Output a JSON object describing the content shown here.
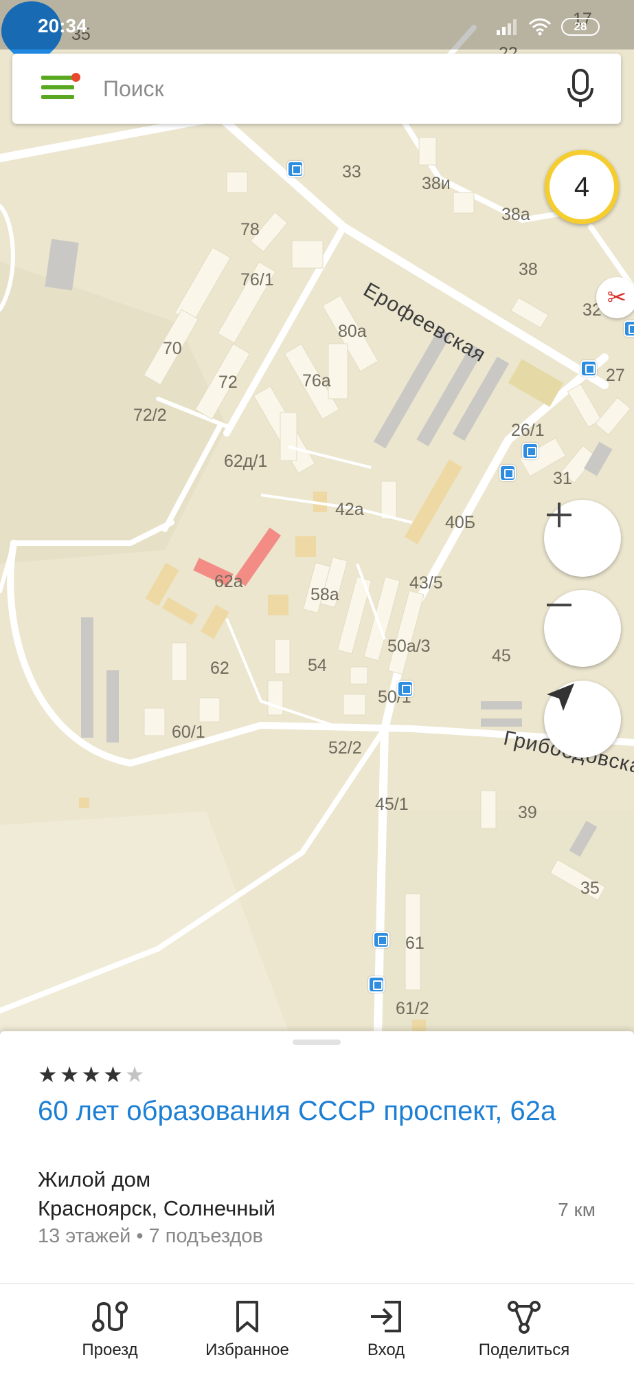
{
  "status_bar": {
    "time": "20:34",
    "battery": "28"
  },
  "search": {
    "placeholder": "Поиск"
  },
  "traffic": {
    "level": "4"
  },
  "map": {
    "streets": [
      "Ерофеевская",
      "Грибоедовская"
    ],
    "house_numbers": [
      "33",
      "38и",
      "38а",
      "78",
      "76/1",
      "38",
      "32",
      "80а",
      "70",
      "72",
      "76а",
      "27",
      "72/2",
      "26/1",
      "62д/1",
      "31",
      "42а",
      "40Б",
      "62а",
      "58а",
      "43/5",
      "50а/3",
      "45",
      "62",
      "54",
      "50/1",
      "60/1",
      "52/2",
      "45/1",
      "39",
      "35",
      "61",
      "61/2",
      "17",
      "22",
      "35"
    ]
  },
  "place": {
    "rating": 4,
    "rating_max": 5,
    "title": "60 лет образования СССР проспект, 62а",
    "type": "Жилой дом",
    "address": "Красноярск, Солнечный",
    "distance": "7 км",
    "details": "13 этажей • 7 подъездов"
  },
  "nav": {
    "route": "Проезд",
    "favorites": "Избранное",
    "login": "Вход",
    "share": "Поделиться"
  }
}
